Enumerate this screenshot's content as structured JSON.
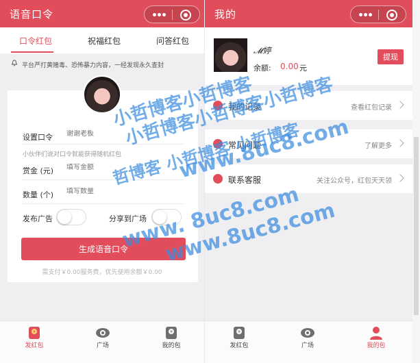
{
  "left": {
    "nav_title": "语音口令",
    "tabs": [
      {
        "label": "口令红包",
        "active": true
      },
      {
        "label": "祝福红包",
        "active": false
      },
      {
        "label": "问答红包",
        "active": false
      }
    ],
    "notice": "平台严打黄赌毒、恐怖暴力内容，一经发现永久查封",
    "form": {
      "command_label": "设置口令",
      "command_placeholder": "谢谢老板",
      "command_hint": "小伙伴们说对口令就能获得随机红包",
      "amount_label": "赏金 (元)",
      "amount_placeholder": "填写金额",
      "count_label": "数量 (个)",
      "count_placeholder": "填写数量",
      "ad_label": "发布广告",
      "share_label": "分享到广场"
    },
    "generate_button": "生成语音口令",
    "fee_text": "需支付￥0.00服务费，优先使用余额￥0.00"
  },
  "right": {
    "nav_title": "我的",
    "profile": {
      "username": "𝓜婷",
      "balance_label": "余额:",
      "balance_value": "0.00",
      "balance_unit": "元",
      "withdraw_button": "提现"
    },
    "menu": [
      {
        "title": "我的记录",
        "desc": "查看红包记录",
        "icon": "record-icon"
      },
      {
        "title": "常见问题",
        "desc": "了解更多",
        "icon": "question-icon"
      },
      {
        "title": "联系客服",
        "desc": "关注公众号，红包天天领",
        "icon": "service-icon"
      }
    ]
  },
  "bottom_tabs": [
    {
      "label": "发红包",
      "icon": "redpacket-icon"
    },
    {
      "label": "广场",
      "icon": "eye-icon"
    },
    {
      "label": "我的包",
      "icon": "person-icon"
    }
  ],
  "watermarks": [
    "小哲博客小哲博客",
    "小哲博客小哲博客小哲博客",
    "哲博客 小哲博客 小哲博客",
    "www.8uc8.com",
    "www. 8uc8.com",
    "www.8uc8.com"
  ],
  "colors": {
    "accent": "#e24d5c",
    "watermark": "#3d8ee0",
    "background": "#efeff2"
  }
}
